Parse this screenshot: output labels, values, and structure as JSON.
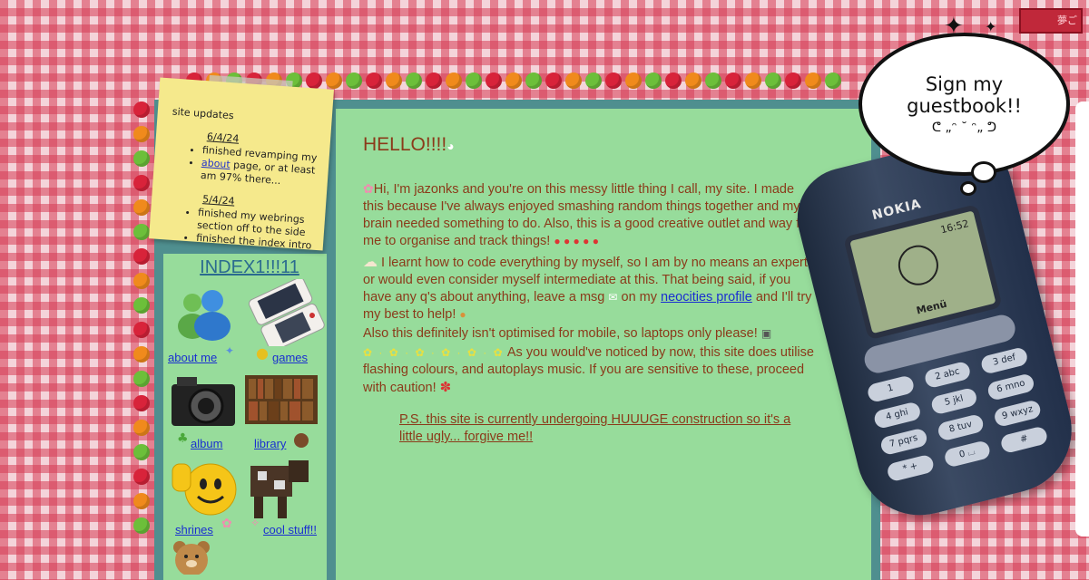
{
  "note": {
    "heading": "site updates",
    "entries": [
      {
        "date": "6/4/24",
        "items": [
          "finished revamping my",
          "page, or at least am 97% there..."
        ],
        "link": "about"
      },
      {
        "date": "5/4/24",
        "items": [
          "finished my webrings section off to the side",
          "finished the index intro"
        ]
      }
    ]
  },
  "sidebar": {
    "title": "INDEX1!!!11",
    "links": {
      "about": "about me",
      "games": "games",
      "album": "album",
      "library": "library",
      "shrines": "shrines",
      "cool": "cool stuff!!"
    }
  },
  "main": {
    "heading": "HELLO!!!!",
    "p1": "Hi, I'm jazonks and you're on this messy little thing I call, my site. I made this because I've always enjoyed smashing random things together and my brain needed something to do. Also, this is a good creative outlet and way for me to organise and track things!",
    "p2a": "I learnt how to code everything by myself, so I am by no means an expert or would even consider myself intermediate at this. That being said, if you have any q's about anything, leave a msg",
    "p2b": "on my",
    "p2_link": "neocities profile",
    "p2c": "and I'll try my best to help!",
    "p3": "Also this definitely isn't optimised for mobile, so laptops only please!",
    "p4": "As you would've noticed by now, this site does utilise flashing colours, and autoplays music. If you are sensitive to these, proceed with caution!",
    "ps": "P.S. this site is currently undergoing HUUUGE construction so it's a little ugly... forgive me!!"
  },
  "phone": {
    "brand": "NOKIA",
    "time": "16:52",
    "menu": "Menü",
    "keys": [
      "1",
      "2 abc",
      "3 def",
      "4 ghi",
      "5 jkl",
      "6 mno",
      "7 pqrs",
      "8 tuv",
      "9 wxyz",
      "* +",
      "0 ⌴",
      "#"
    ]
  },
  "guestbook": {
    "line1": "Sign my",
    "line2": "guestbook!!",
    "kaomoji": "ᕦ „ᵔ ˘ ᵔ„ ᕤ"
  },
  "corner_button": "夢ご",
  "colors": {
    "panel_green": "#97dc9b",
    "frame_teal": "#4f8f8f",
    "text_brown": "#8b3a1a",
    "link_blue": "#1a2fd0",
    "gingham_red": "#d63c56"
  }
}
